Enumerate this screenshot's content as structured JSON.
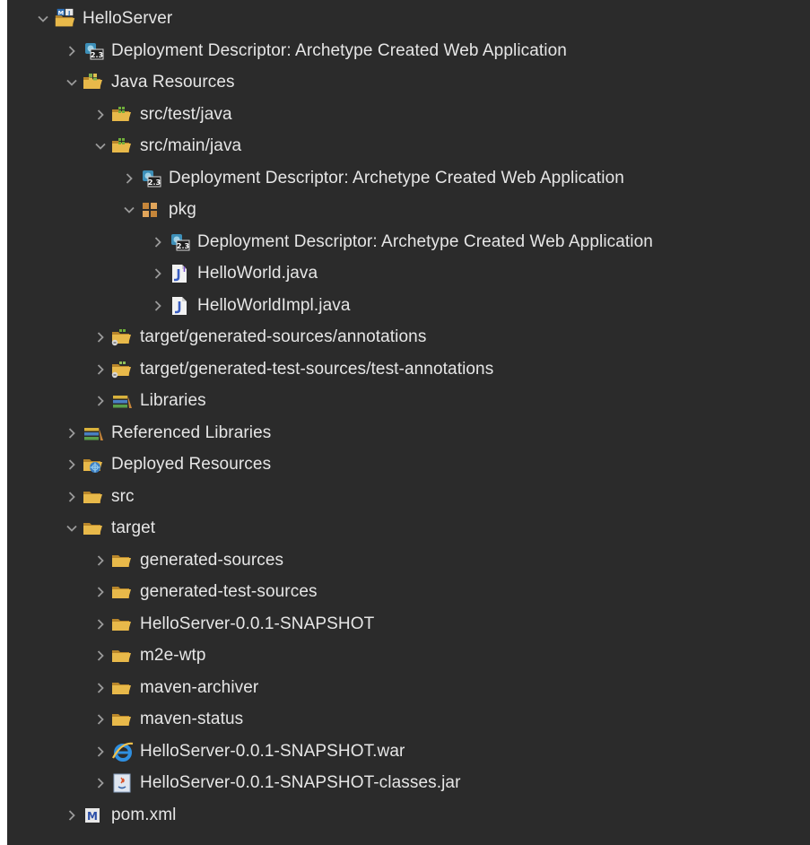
{
  "colors": {
    "panel_background": "#2b2b2b",
    "text": "#e6e6e6",
    "chevron": "#9a9a9a",
    "folder": "#e8b94a",
    "package": "#c6863a",
    "library": "#d9b23c"
  },
  "tree": [
    {
      "id": "helloserver",
      "label": "HelloServer",
      "icon": "maven-web-project-icon",
      "expanded": true,
      "depth": 0
    },
    {
      "id": "dd-root",
      "label": "Deployment Descriptor: Archetype Created Web Application",
      "icon": "deployment-descriptor-icon",
      "expanded": false,
      "depth": 1
    },
    {
      "id": "java-resources",
      "label": "Java Resources",
      "icon": "java-resources-icon",
      "expanded": true,
      "depth": 1
    },
    {
      "id": "src-test-java",
      "label": "src/test/java",
      "icon": "source-folder-icon",
      "expanded": false,
      "depth": 2
    },
    {
      "id": "src-main-java",
      "label": "src/main/java",
      "icon": "source-folder-icon",
      "expanded": true,
      "depth": 2
    },
    {
      "id": "dd-main",
      "label": "Deployment Descriptor: Archetype Created Web Application",
      "icon": "deployment-descriptor-icon",
      "expanded": false,
      "depth": 3
    },
    {
      "id": "pkg",
      "label": "pkg",
      "icon": "package-icon",
      "expanded": true,
      "depth": 3
    },
    {
      "id": "dd-pkg",
      "label": "Deployment Descriptor: Archetype Created Web Application",
      "icon": "deployment-descriptor-icon",
      "expanded": false,
      "depth": 4
    },
    {
      "id": "helloworld-java",
      "label": "HelloWorld.java",
      "icon": "java-interface-file-icon",
      "expanded": false,
      "depth": 4
    },
    {
      "id": "helloworldimpl-java",
      "label": "HelloWorldImpl.java",
      "icon": "java-file-icon",
      "expanded": false,
      "depth": 4
    },
    {
      "id": "gen-sources-annotations",
      "label": "target/generated-sources/annotations",
      "icon": "generated-source-folder-icon",
      "expanded": false,
      "depth": 2
    },
    {
      "id": "gen-test-sources",
      "label": "target/generated-test-sources/test-annotations",
      "icon": "generated-test-source-folder-icon",
      "expanded": false,
      "depth": 2
    },
    {
      "id": "libraries",
      "label": "Libraries",
      "icon": "libraries-icon",
      "expanded": false,
      "depth": 2
    },
    {
      "id": "referenced-libraries",
      "label": "Referenced Libraries",
      "icon": "libraries-icon",
      "expanded": false,
      "depth": 1
    },
    {
      "id": "deployed-resources",
      "label": "Deployed Resources",
      "icon": "deployed-resources-icon",
      "expanded": false,
      "depth": 1
    },
    {
      "id": "src",
      "label": "src",
      "icon": "folder-icon",
      "expanded": false,
      "depth": 1
    },
    {
      "id": "target",
      "label": "target",
      "icon": "folder-icon",
      "expanded": true,
      "depth": 1
    },
    {
      "id": "generated-sources",
      "label": "generated-sources",
      "icon": "folder-icon",
      "expanded": false,
      "depth": 2
    },
    {
      "id": "generated-test-sources",
      "label": "generated-test-sources",
      "icon": "folder-icon",
      "expanded": false,
      "depth": 2
    },
    {
      "id": "helloserver-snapshot",
      "label": "HelloServer-0.0.1-SNAPSHOT",
      "icon": "folder-icon",
      "expanded": false,
      "depth": 2
    },
    {
      "id": "m2e-wtp",
      "label": "m2e-wtp",
      "icon": "folder-icon",
      "expanded": false,
      "depth": 2
    },
    {
      "id": "maven-archiver",
      "label": "maven-archiver",
      "icon": "folder-icon",
      "expanded": false,
      "depth": 2
    },
    {
      "id": "maven-status",
      "label": "maven-status",
      "icon": "folder-icon",
      "expanded": false,
      "depth": 2
    },
    {
      "id": "war-file",
      "label": "HelloServer-0.0.1-SNAPSHOT.war",
      "icon": "war-file-icon",
      "expanded": false,
      "depth": 2
    },
    {
      "id": "classes-jar",
      "label": "HelloServer-0.0.1-SNAPSHOT-classes.jar",
      "icon": "jar-file-icon",
      "expanded": false,
      "depth": 2
    },
    {
      "id": "pom-xml",
      "label": "pom.xml",
      "icon": "maven-pom-icon",
      "expanded": false,
      "depth": 1
    }
  ]
}
